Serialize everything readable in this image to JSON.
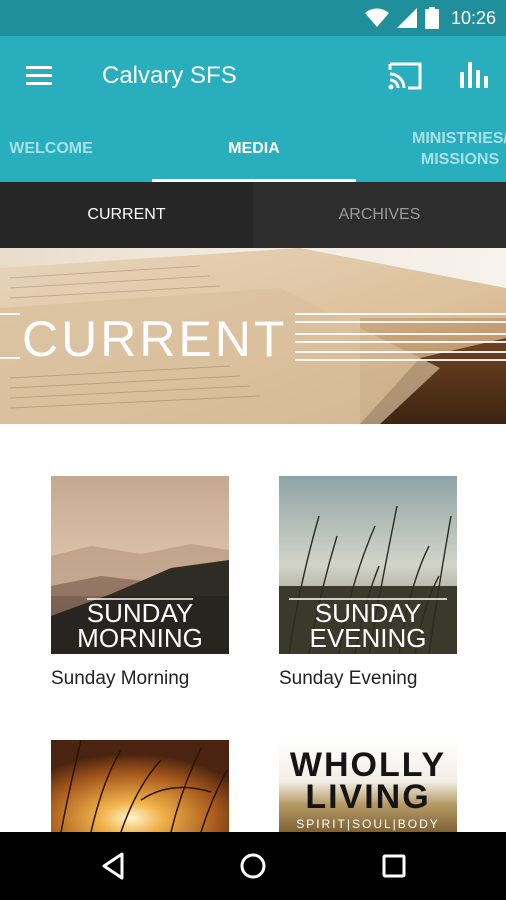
{
  "status_bar": {
    "time": "10:26",
    "icons": [
      "wifi-icon",
      "cellular-signal-icon",
      "battery-icon"
    ]
  },
  "app_bar": {
    "title": "Calvary SFS",
    "icons": [
      "menu-icon",
      "cast-icon",
      "stats-icon"
    ]
  },
  "tabs": {
    "items": [
      {
        "label": "WELCOME"
      },
      {
        "label": "MEDIA"
      },
      {
        "label_line1": "MINISTRIES/",
        "label_line2": "MISSIONS"
      }
    ],
    "active": "MEDIA"
  },
  "subtabs": {
    "current": "CURRENT",
    "archives": "ARCHIVES"
  },
  "banner": {
    "text": "CURRENT"
  },
  "media_items": [
    {
      "label": "Sunday Morning",
      "art_line1": "SUNDAY",
      "art_line2": "MORNING"
    },
    {
      "label": "Sunday Evening",
      "art_line1": "SUNDAY",
      "art_line2": "EVENING"
    },
    {
      "label": "",
      "art_line1": "",
      "art_line2": ""
    },
    {
      "label": "",
      "art_line1": "WHOLLY",
      "art_line2": "LIVING",
      "art_line3": "SPIRIT|SOUL|BODY"
    }
  ],
  "nav_bar": {
    "icons": [
      "back-icon",
      "home-icon",
      "recents-icon"
    ]
  },
  "colors": {
    "status_bar": "#1f8f9b",
    "app_bar": "#28aebd",
    "subtabs_bg": "#2a2a2a",
    "nav_bar": "#000000"
  }
}
